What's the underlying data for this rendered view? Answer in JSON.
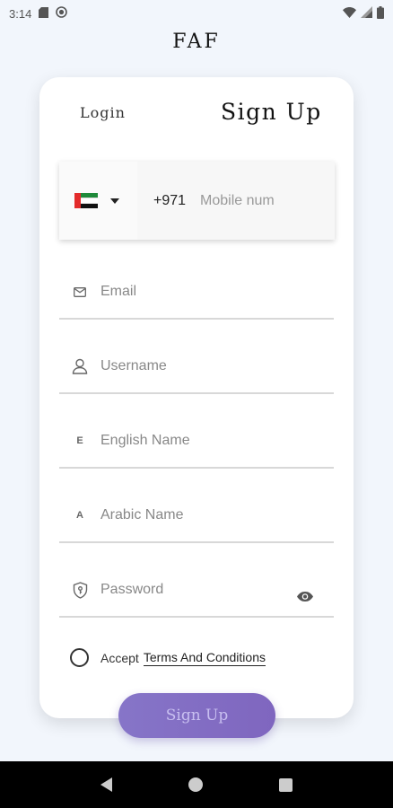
{
  "status_bar": {
    "time": "3:14"
  },
  "app": {
    "title": "FAF"
  },
  "tabs": {
    "login": "Login",
    "signup": "Sign Up"
  },
  "phone": {
    "dial_code": "+971",
    "placeholder": "Mobile num",
    "flag": "uae-flag-icon"
  },
  "fields": {
    "email": {
      "placeholder": "Email",
      "icon": "mail-icon"
    },
    "username": {
      "placeholder": "Username",
      "icon": "user-icon"
    },
    "english_name": {
      "placeholder": "English Name",
      "icon_letter": "E"
    },
    "arabic_name": {
      "placeholder": "Arabic Name",
      "icon_letter": "A"
    },
    "password": {
      "placeholder": "Password",
      "icon": "shield-key-icon",
      "toggle_icon": "eye-icon"
    }
  },
  "terms": {
    "accept_label": "Accept",
    "link_label": "Terms And Conditions"
  },
  "buttons": {
    "signup": "Sign Up"
  },
  "colors": {
    "accent": "#8675c8",
    "background": "#f2f6fc",
    "flag_red": "#e32b2b",
    "flag_green": "#1f8a3a"
  }
}
